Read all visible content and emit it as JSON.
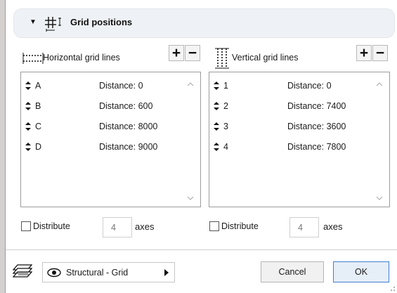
{
  "section": {
    "title": "Grid positions"
  },
  "horizontal": {
    "label": "Horizontal grid lines",
    "add_label": "+",
    "remove_label": "−",
    "rows": [
      {
        "name": "A",
        "distance": "Distance: 0"
      },
      {
        "name": "B",
        "distance": "Distance: 600"
      },
      {
        "name": "C",
        "distance": "Distance: 8000"
      },
      {
        "name": "D",
        "distance": "Distance: 9000"
      }
    ],
    "distribute": {
      "label": "Distribute",
      "checked": false,
      "count": "4",
      "axes_label": "axes"
    }
  },
  "vertical": {
    "label": "Vertical grid lines",
    "add_label": "+",
    "remove_label": "−",
    "rows": [
      {
        "name": "1",
        "distance": "Distance: 0"
      },
      {
        "name": "2",
        "distance": "Distance: 7400"
      },
      {
        "name": "3",
        "distance": "Distance: 3600"
      },
      {
        "name": "4",
        "distance": "Distance: 7800"
      }
    ],
    "distribute": {
      "label": "Distribute",
      "checked": false,
      "count": "4",
      "axes_label": "axes"
    }
  },
  "footer": {
    "layer": "Structural - Grid",
    "cancel_label": "Cancel",
    "ok_label": "OK"
  },
  "icons": {
    "section_toggle": "triangle-down-icon",
    "section": "grid-icon",
    "horizontal": "horizontal-grid-lines-icon",
    "vertical": "vertical-grid-lines-icon",
    "row_handle": "drag-handle-icon",
    "layer": "layer-icon",
    "eye": "eye-icon",
    "dropdown": "chevron-right-icon"
  },
  "colors": {
    "ok_border": "#3f7fd0",
    "header_bg": "#eef1f5"
  }
}
